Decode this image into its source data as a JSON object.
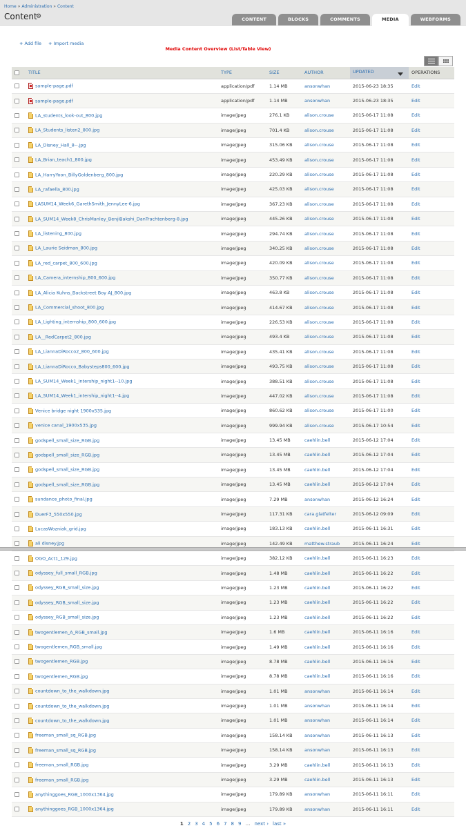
{
  "breadcrumb": [
    "Home",
    "Administration",
    "Content"
  ],
  "page_title": "Content",
  "tabs": [
    {
      "label": "CONTENT",
      "active": false
    },
    {
      "label": "BLOCKS",
      "active": false
    },
    {
      "label": "COMMENTS",
      "active": false
    },
    {
      "label": "MEDIA",
      "active": true
    },
    {
      "label": "WEBFORMS",
      "active": false
    }
  ],
  "actions": {
    "add_file": "Add file",
    "import_media": "Import media"
  },
  "overview_label": "Media Content Overview (List/Table View)",
  "columns": {
    "title": "TITLE",
    "type": "TYPE",
    "size": "SIZE",
    "author": "AUTHOR",
    "updated": "UPDATED",
    "operations": "OPERATIONS"
  },
  "rows": [
    {
      "title": "sample-page.pdf",
      "type": "application/pdf",
      "size": "1.14 MB",
      "author": "ansonwhan",
      "updated": "2015-06-23 18:35",
      "op": "Edit",
      "icon": "pdf"
    },
    {
      "title": "sample-page.pdf",
      "type": "application/pdf",
      "size": "1.14 MB",
      "author": "ansonwhan",
      "updated": "2015-06-23 18:35",
      "op": "Edit",
      "icon": "pdf"
    },
    {
      "title": "LA_students_look-out_800.jpg",
      "type": "image/jpeg",
      "size": "276.1 KB",
      "author": "alison.crouse",
      "updated": "2015-06-17 11:08",
      "op": "Edit",
      "icon": "image"
    },
    {
      "title": "LA_Students_listen2_800.jpg",
      "type": "image/jpeg",
      "size": "701.4 KB",
      "author": "alison.crouse",
      "updated": "2015-06-17 11:08",
      "op": "Edit",
      "icon": "image"
    },
    {
      "title": "LA_Disney_Hall_8--.jpg",
      "type": "image/jpeg",
      "size": "315.06 KB",
      "author": "alison.crouse",
      "updated": "2015-06-17 11:08",
      "op": "Edit",
      "icon": "image"
    },
    {
      "title": "LA_Brian_teach1_800.jpg",
      "type": "image/jpeg",
      "size": "453.49 KB",
      "author": "alison.crouse",
      "updated": "2015-06-17 11:08",
      "op": "Edit",
      "icon": "image"
    },
    {
      "title": "LA_HarryYoon_BillyGoldenberg_800.jpg",
      "type": "image/jpeg",
      "size": "220.29 KB",
      "author": "alison.crouse",
      "updated": "2015-06-17 11:08",
      "op": "Edit",
      "icon": "image"
    },
    {
      "title": "LA_rafaella_800.jpg",
      "type": "image/jpeg",
      "size": "425.03 KB",
      "author": "alison.crouse",
      "updated": "2015-06-17 11:08",
      "op": "Edit",
      "icon": "image"
    },
    {
      "title": "LASUM14_Week6_GarethSmith_JennyLee-6.jpg",
      "type": "image/jpeg",
      "size": "367.23 KB",
      "author": "alison.crouse",
      "updated": "2015-06-17 11:08",
      "op": "Edit",
      "icon": "image"
    },
    {
      "title": "LA_SUM14_Week8_ChrisManley_BenjiBakshi_DanTrachtenberg-8.jpg",
      "type": "image/jpeg",
      "size": "445.26 KB",
      "author": "alison.crouse",
      "updated": "2015-06-17 11:08",
      "op": "Edit",
      "icon": "image"
    },
    {
      "title": "LA_listening_800.jpg",
      "type": "image/jpeg",
      "size": "294.74 KB",
      "author": "alison.crouse",
      "updated": "2015-06-17 11:08",
      "op": "Edit",
      "icon": "image"
    },
    {
      "title": "LA_Laurie Seidman_800.jpg",
      "type": "image/jpeg",
      "size": "340.25 KB",
      "author": "alison.crouse",
      "updated": "2015-06-17 11:08",
      "op": "Edit",
      "icon": "image"
    },
    {
      "title": "LA_red_carpet_800_600.jpg",
      "type": "image/jpeg",
      "size": "420.09 KB",
      "author": "alison.crouse",
      "updated": "2015-06-17 11:08",
      "op": "Edit",
      "icon": "image"
    },
    {
      "title": "LA_Camera_internship_800_600.jpg",
      "type": "image/jpeg",
      "size": "350.77 KB",
      "author": "alison.crouse",
      "updated": "2015-06-17 11:08",
      "op": "Edit",
      "icon": "image"
    },
    {
      "title": "LA_Alicia Kuhns_Backstreet Boy AJ_800.jpg",
      "type": "image/jpeg",
      "size": "463.8 KB",
      "author": "alison.crouse",
      "updated": "2015-06-17 11:08",
      "op": "Edit",
      "icon": "image"
    },
    {
      "title": "LA_Commercial_shoot_800.jpg",
      "type": "image/jpeg",
      "size": "414.67 KB",
      "author": "alison.crouse",
      "updated": "2015-06-17 11:08",
      "op": "Edit",
      "icon": "image"
    },
    {
      "title": "LA_Lighting_internship_800_600.jpg",
      "type": "image/jpeg",
      "size": "226.53 KB",
      "author": "alison.crouse",
      "updated": "2015-06-17 11:08",
      "op": "Edit",
      "icon": "image"
    },
    {
      "title": "LA__RedCarpet2_800.jpg",
      "type": "image/jpeg",
      "size": "493.4 KB",
      "author": "alison.crouse",
      "updated": "2015-06-17 11:08",
      "op": "Edit",
      "icon": "image"
    },
    {
      "title": "LA_LiannaDiRocco2_800_600.jpg",
      "type": "image/jpeg",
      "size": "435.41 KB",
      "author": "alison.crouse",
      "updated": "2015-06-17 11:08",
      "op": "Edit",
      "icon": "image"
    },
    {
      "title": "LA_LiannaDiRocco_Babysteps800_600.jpg",
      "type": "image/jpeg",
      "size": "493.75 KB",
      "author": "alison.crouse",
      "updated": "2015-06-17 11:08",
      "op": "Edit",
      "icon": "image"
    },
    {
      "title": "LA_SUM14_Week1_intership_night1--10.jpg",
      "type": "image/jpeg",
      "size": "388.51 KB",
      "author": "alison.crouse",
      "updated": "2015-06-17 11:08",
      "op": "Edit",
      "icon": "image"
    },
    {
      "title": "LA_SUM14_Week1_intership_night1--4.jpg",
      "type": "image/jpeg",
      "size": "447.02 KB",
      "author": "alison.crouse",
      "updated": "2015-06-17 11:08",
      "op": "Edit",
      "icon": "image"
    },
    {
      "title": "Venice bridge night 1900x535.jpg",
      "type": "image/jpeg",
      "size": "860.62 KB",
      "author": "alison.crouse",
      "updated": "2015-06-17 11:00",
      "op": "Edit",
      "icon": "image"
    },
    {
      "title": "venice canal_1900x535.jpg",
      "type": "image/jpeg",
      "size": "999.94 KB",
      "author": "alison.crouse",
      "updated": "2015-06-17 10:54",
      "op": "Edit",
      "icon": "image"
    },
    {
      "title": "godspell_small_size_RGB.jpg",
      "type": "image/jpeg",
      "size": "13.45 MB",
      "author": "caehlin.bell",
      "updated": "2015-06-12 17:04",
      "op": "Edit",
      "icon": "image"
    },
    {
      "title": "godspell_small_size_RGB.jpg",
      "type": "image/jpeg",
      "size": "13.45 MB",
      "author": "caehlin.bell",
      "updated": "2015-06-12 17:04",
      "op": "Edit",
      "icon": "image"
    },
    {
      "title": "godspell_small_size_RGB.jpg",
      "type": "image/jpeg",
      "size": "13.45 MB",
      "author": "caehlin.bell",
      "updated": "2015-06-12 17:04",
      "op": "Edit",
      "icon": "image"
    },
    {
      "title": "godspell_small_size_RGB.jpg",
      "type": "image/jpeg",
      "size": "13.45 MB",
      "author": "caehlin.bell",
      "updated": "2015-06-12 17:04",
      "op": "Edit",
      "icon": "image"
    },
    {
      "title": "sundance_photo_final.jpg",
      "type": "image/jpeg",
      "size": "7.29 MB",
      "author": "ansonwhan",
      "updated": "2015-06-12 16:24",
      "op": "Edit",
      "icon": "image"
    },
    {
      "title": "DuerF3_550x550.jpg",
      "type": "image/jpeg",
      "size": "117.31 KB",
      "author": "cara.glatfelter",
      "updated": "2015-06-12 09:09",
      "op": "Edit",
      "icon": "image"
    },
    {
      "title": "LucasWozniak_grid.jpg",
      "type": "image/jpeg",
      "size": "183.13 KB",
      "author": "caehlin.bell",
      "updated": "2015-06-11 16:31",
      "op": "Edit",
      "icon": "image"
    },
    {
      "title": "ali disney.jpg",
      "type": "image/jpeg",
      "size": "142.49 KB",
      "author": "matthew.straub",
      "updated": "2015-06-11 16:24",
      "op": "Edit",
      "icon": "image"
    },
    {
      "title": "OGO_Act1_129.jpg",
      "type": "image/jpeg",
      "size": "382.12 KB",
      "author": "caehlin.bell",
      "updated": "2015-06-11 16:23",
      "op": "Edit",
      "icon": "image"
    },
    {
      "title": "odyssey_full_small_RGB.jpg",
      "type": "image/jpeg",
      "size": "1.48 MB",
      "author": "caehlin.bell",
      "updated": "2015-06-11 16:22",
      "op": "Edit",
      "icon": "image"
    },
    {
      "title": "odyssey_RGB_small_size.jpg",
      "type": "image/jpeg",
      "size": "1.23 MB",
      "author": "caehlin.bell",
      "updated": "2015-06-11 16:22",
      "op": "Edit",
      "icon": "image"
    },
    {
      "title": "odyssey_RGB_small_size.jpg",
      "type": "image/jpeg",
      "size": "1.23 MB",
      "author": "caehlin.bell",
      "updated": "2015-06-11 16:22",
      "op": "Edit",
      "icon": "image"
    },
    {
      "title": "odyssey_RGB_small_size.jpg",
      "type": "image/jpeg",
      "size": "1.23 MB",
      "author": "caehlin.bell",
      "updated": "2015-06-11 16:22",
      "op": "Edit",
      "icon": "image"
    },
    {
      "title": "twogentlemen_A_RGB_small.jpg",
      "type": "image/jpeg",
      "size": "1.6 MB",
      "author": "caehlin.bell",
      "updated": "2015-06-11 16:16",
      "op": "Edit",
      "icon": "image"
    },
    {
      "title": "twogentlemen_RGB_small.jpg",
      "type": "image/jpeg",
      "size": "1.49 MB",
      "author": "caehlin.bell",
      "updated": "2015-06-11 16:16",
      "op": "Edit",
      "icon": "image"
    },
    {
      "title": "twogentlemen_RGB.jpg",
      "type": "image/jpeg",
      "size": "8.78 MB",
      "author": "caehlin.bell",
      "updated": "2015-06-11 16:16",
      "op": "Edit",
      "icon": "image"
    },
    {
      "title": "twogentlemen_RGB.jpg",
      "type": "image/jpeg",
      "size": "8.78 MB",
      "author": "caehlin.bell",
      "updated": "2015-06-11 16:16",
      "op": "Edit",
      "icon": "image"
    },
    {
      "title": "countdown_to_the_walkdown.jpg",
      "type": "image/jpeg",
      "size": "1.01 MB",
      "author": "ansonwhan",
      "updated": "2015-06-11 16:14",
      "op": "Edit",
      "icon": "image"
    },
    {
      "title": "countdown_to_the_walkdown.jpg",
      "type": "image/jpeg",
      "size": "1.01 MB",
      "author": "ansonwhan",
      "updated": "2015-06-11 16:14",
      "op": "Edit",
      "icon": "image"
    },
    {
      "title": "countdown_to_the_walkdown.jpg",
      "type": "image/jpeg",
      "size": "1.01 MB",
      "author": "ansonwhan",
      "updated": "2015-06-11 16:14",
      "op": "Edit",
      "icon": "image"
    },
    {
      "title": "freeman_small_sq_RGB.jpg",
      "type": "image/jpeg",
      "size": "158.14 KB",
      "author": "ansonwhan",
      "updated": "2015-06-11 16:13",
      "op": "Edit",
      "icon": "image"
    },
    {
      "title": "freeman_small_sq_RGB.jpg",
      "type": "image/jpeg",
      "size": "158.14 KB",
      "author": "ansonwhan",
      "updated": "2015-06-11 16:13",
      "op": "Edit",
      "icon": "image"
    },
    {
      "title": "freeman_small_RGB.jpg",
      "type": "image/jpeg",
      "size": "3.29 MB",
      "author": "caehlin.bell",
      "updated": "2015-06-11 16:13",
      "op": "Edit",
      "icon": "image"
    },
    {
      "title": "freeman_small_RGB.jpg",
      "type": "image/jpeg",
      "size": "3.29 MB",
      "author": "caehlin.bell",
      "updated": "2015-06-11 16:13",
      "op": "Edit",
      "icon": "image"
    },
    {
      "title": "anythinggoes_RGB_1000x1364.jpg",
      "type": "image/jpeg",
      "size": "179.89 KB",
      "author": "ansonwhan",
      "updated": "2015-06-11 16:11",
      "op": "Edit",
      "icon": "image"
    },
    {
      "title": "anythinggoes_RGB_1000x1364.jpg",
      "type": "image/jpeg",
      "size": "179.89 KB",
      "author": "ansonwhan",
      "updated": "2015-06-11 16:11",
      "op": "Edit",
      "icon": "image"
    }
  ],
  "pager": {
    "pages": [
      "1",
      "2",
      "3",
      "4",
      "5",
      "6",
      "7",
      "8",
      "9"
    ],
    "current": "1",
    "ellipsis": "…",
    "next": "next ›",
    "last": "last »"
  }
}
